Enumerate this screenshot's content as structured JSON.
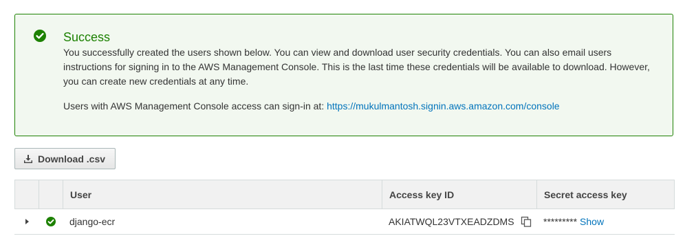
{
  "alert": {
    "icon": "success-check-icon",
    "title": "Success",
    "message": "You successfully created the users shown below. You can view and download user security credentials. You can also email users instructions for signing in to the AWS Management Console. This is the last time these credentials will be available to download. However, you can create new credentials at any time.",
    "signin_prefix": "Users with AWS Management Console access can sign-in at: ",
    "signin_url": "https://mukulmantosh.signin.aws.amazon.com/console",
    "color": "#1d8102"
  },
  "toolbar": {
    "download_icon": "download-icon",
    "download_label": "Download .csv"
  },
  "table": {
    "columns": [
      "User",
      "Access key ID",
      "Secret access key"
    ],
    "rows": [
      {
        "user": "django-ecr",
        "access_key_id": "AKIATWQL23VTXEADZDMS",
        "secret_masked": "*********",
        "show_label": "Show"
      }
    ]
  },
  "colors": {
    "link": "#0073bb",
    "success": "#1d8102"
  }
}
